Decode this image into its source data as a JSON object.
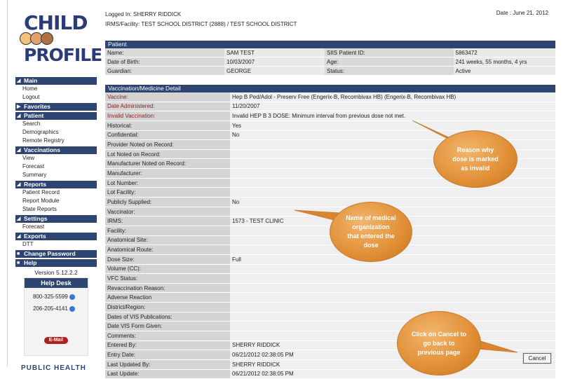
{
  "header": {
    "logged_in": "Logged In: SHERRY RIDDICK",
    "facility": "IRMS/Facility: TEST SCHOOL DISTRICT (2888) / TEST SCHOOL DISTRICT",
    "date": "Date : June 21, 2012",
    "logo_line1": "CHILD",
    "logo_line2": "PROFILE"
  },
  "sidebar": {
    "sections": [
      {
        "title": "Main",
        "items": [
          "Home",
          "Logout"
        ]
      },
      {
        "title": "Favorites",
        "items": []
      },
      {
        "title": "Patient",
        "items": [
          "Search",
          "Demographics",
          "Remote Registry"
        ]
      },
      {
        "title": "Vaccinations",
        "items": [
          "View",
          "Forecast",
          "Summary"
        ]
      },
      {
        "title": "Reports",
        "items": [
          "Patient Record",
          "Report Module",
          "State Reports"
        ]
      },
      {
        "title": "Settings",
        "items": [
          "Forecast"
        ]
      },
      {
        "title": "Exports",
        "items": [
          "DTT"
        ]
      },
      {
        "title": "Change Password",
        "items": []
      },
      {
        "title": "Help",
        "items": []
      }
    ],
    "version": "Version 5.12.2.2",
    "helpdesk_title": "Help Desk",
    "phone1": "800-325-5599",
    "phone2": "206-205-4141",
    "email_label": "E-Mail",
    "bottom_text": "PUBLIC HEALTH"
  },
  "patient": {
    "title": "Patient",
    "rows": [
      {
        "l1": "Name:",
        "v1": "SAM TEST",
        "l2": "SIIS Patient ID:",
        "v2": "5863472"
      },
      {
        "l1": "Date of Birth:",
        "v1": "10/03/2007",
        "l2": "Age:",
        "v2": "241 weeks, 55 months, 4 yrs"
      },
      {
        "l1": "Guardian:",
        "v1": "GEORGE",
        "l2": "Status:",
        "v2": "Active"
      }
    ]
  },
  "vaccination": {
    "title": "Vaccination/Medicine Detail",
    "rows": [
      {
        "label": "Vaccine:",
        "value": "Hep B Ped/Adol - Preserv Free (Engerix-B, Recombivax HB) (Engerix-B, Recombivax HB)",
        "req": true
      },
      {
        "label": "Date Administered:",
        "value": "11/20/2007",
        "req": true
      },
      {
        "label": "Invalid Vaccination:",
        "value": "Invalid HEP B 3 DOSE: Minimum interval from previous dose not met.",
        "req": true
      },
      {
        "label": "Historical:",
        "value": "Yes",
        "req": false
      },
      {
        "label": "Confidential:",
        "value": "No",
        "req": false
      },
      {
        "label": "Provider Noted on Record:",
        "value": "",
        "req": false
      },
      {
        "label": "Lot Noted on Record:",
        "value": "",
        "req": false
      },
      {
        "label": "Manufacturer Noted on Record:",
        "value": "",
        "req": false
      },
      {
        "label": "Manufacturer:",
        "value": "",
        "req": false
      },
      {
        "label": "Lot Number:",
        "value": "",
        "req": false
      },
      {
        "label": "Lot Facility:",
        "value": "",
        "req": false
      },
      {
        "label": "Publicly Supplied:",
        "value": "No",
        "req": false
      },
      {
        "label": "Vaccinator:",
        "value": "",
        "req": false
      },
      {
        "label": "IRMS:",
        "value": "1573 - TEST CLINIC",
        "req": false
      },
      {
        "label": "Facility:",
        "value": "",
        "req": false
      },
      {
        "label": "Anatomical Site:",
        "value": "",
        "req": false
      },
      {
        "label": "Anatomical Route:",
        "value": "",
        "req": false
      },
      {
        "label": "Dose Size:",
        "value": "Full",
        "req": false
      },
      {
        "label": "Volume (CC):",
        "value": "",
        "req": false
      },
      {
        "label": "VFC Status:",
        "value": "",
        "req": false
      },
      {
        "label": "Revaccination Reason:",
        "value": "",
        "req": false
      },
      {
        "label": "Adverse Reaction",
        "value": "",
        "req": false
      },
      {
        "label": "District/Region:",
        "value": "",
        "req": false
      },
      {
        "label": "Dates of VIS Publications:",
        "value": "",
        "req": false
      },
      {
        "label": "Date VIS Form Given:",
        "value": "",
        "req": false
      },
      {
        "label": "Comments:",
        "value": "",
        "req": false
      },
      {
        "label": "Entered By:",
        "value": "SHERRY RIDDICK",
        "req": false
      },
      {
        "label": "Entry Date:",
        "value": "06/21/2012 02:38:05 PM",
        "req": false
      },
      {
        "label": "Last Updated By:",
        "value": "SHERRY RIDDICK",
        "req": false
      },
      {
        "label": "Last Update:",
        "value": "06/21/2012 02:38:05 PM",
        "req": false
      }
    ]
  },
  "buttons": {
    "cancel": "Cancel"
  },
  "callouts": {
    "c1": "Reason why dose is marked as invalid",
    "c2": "Name of medical organization that entered the dose",
    "c3": "Click on Cancel to go back to previous page"
  }
}
